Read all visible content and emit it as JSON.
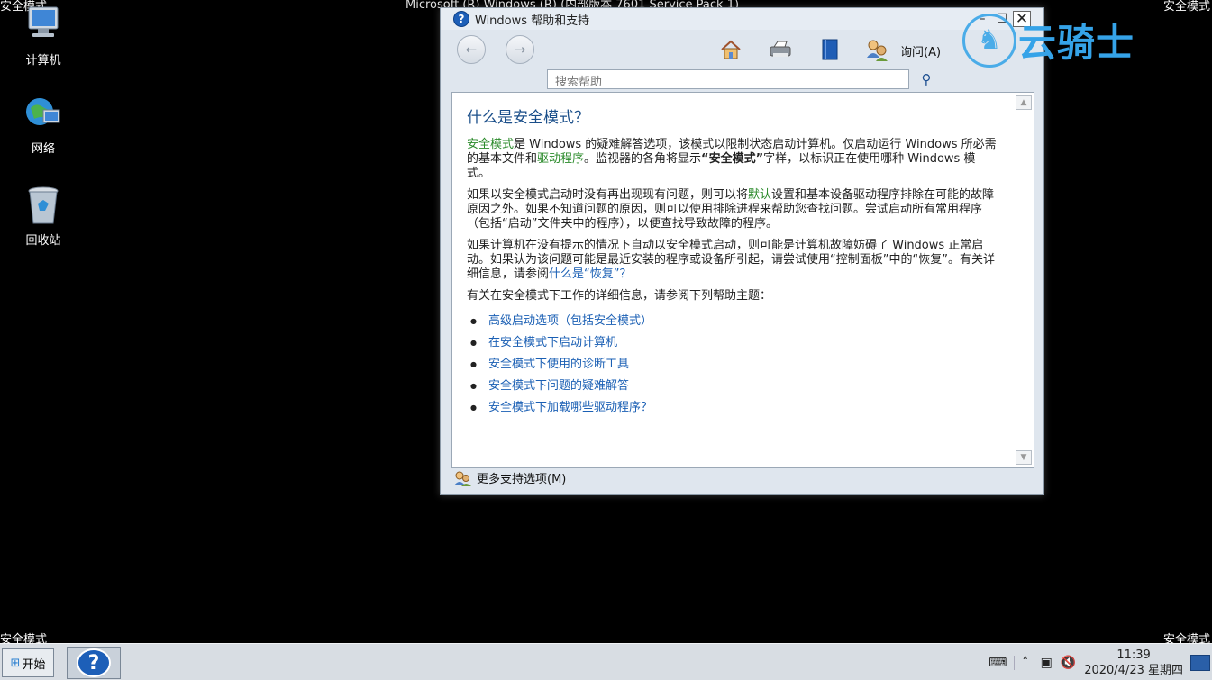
{
  "desktop": {
    "corner_text": "安全模式",
    "top_title": "Microsoft (R) Windows (R) (内部版本 7601 Service Pack 1)",
    "icons": [
      {
        "label": "计算机",
        "icon": "computer-icon"
      },
      {
        "label": "网络",
        "icon": "network-icon"
      },
      {
        "label": "回收站",
        "icon": "recycle-bin-icon"
      }
    ]
  },
  "window": {
    "title": "Windows 帮助和支持",
    "title_icon": "?",
    "toolbar": {
      "back_icon": "back-arrow-icon",
      "forward_icon": "forward-arrow-icon",
      "icons": [
        "home-icon",
        "print-icon",
        "browse-help-icon",
        "ask-icon"
      ],
      "ask_label": "询问(A)"
    },
    "search": {
      "placeholder": "搜索帮助"
    },
    "article": {
      "heading": "什么是安全模式？",
      "p1": {
        "pre": "安全模式",
        "mid1": "是 Windows 的疑难解答选项，该模式以限制状态启动计算机。仅启动运行 Windows 所必需的基本文件和",
        "link": "驱动程序",
        "mid2": "。监视器的各角将显示",
        "bold": "“安全模式”",
        "post": "字样，以标识正在使用哪种 Windows 模式。"
      },
      "p2": {
        "pre": "如果以安全模式启动时没有再出现现有问题，则可以将",
        "link": "默认",
        "post": "设置和基本设备驱动程序排除在可能的故障原因之外。如果不知道问题的原因，则可以使用排除进程来帮助您查找问题。尝试启动所有常用程序（包括“启动”文件夹中的程序），以便查找导致故障的程序。"
      },
      "p3": {
        "pre": "如果计算机在没有提示的情况下自动以安全模式启动，则可能是计算机故障妨碍了 Windows 正常启动。如果认为该问题可能是最近安装的程序或设备所引起，请尝试使用“控制面板”中的“恢复”。有关详细信息，请参阅",
        "link": "什么是“恢复”？"
      },
      "p4": "有关在安全模式下工作的详细信息，请参阅下列帮助主题：",
      "links": [
        "高级启动选项（包括安全模式）",
        "在安全模式下启动计算机",
        "安全模式下使用的诊断工具",
        "安全模式下问题的疑难解答",
        "安全模式下加载哪些驱动程序？"
      ]
    },
    "footer_label": "更多支持选项(M)"
  },
  "watermark": {
    "text": "云骑士"
  },
  "taskbar": {
    "start_label": "开始",
    "time": "11:39",
    "date": "2020/4/23 星期四",
    "tray_icons": [
      "keyboard-icon",
      "show-hidden-icons-icon",
      "network-tray-icon",
      "volume-muted-icon"
    ]
  },
  "colors": {
    "link": "#1a5fb4",
    "glossary": "#2a8a2a",
    "heading": "#1b4f8a",
    "watermark": "#35a3e8"
  }
}
